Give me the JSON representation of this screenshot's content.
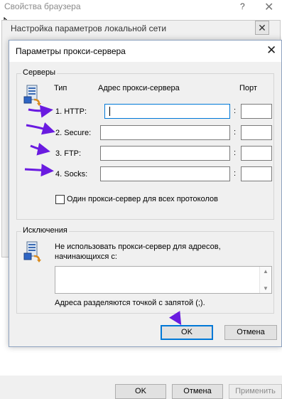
{
  "browser_window": {
    "title": "Свойства браузера",
    "help_glyph": "?",
    "close_glyph": "✕",
    "buttons": {
      "ok": "OK",
      "cancel": "Отмена",
      "apply": "Применить"
    }
  },
  "lan_window": {
    "title": "Настройка параметров локальной сети",
    "close_glyph": "✕"
  },
  "proxy_dialog": {
    "title": "Параметры прокси-сервера",
    "close_glyph": "✕",
    "servers_group": {
      "label": "Серверы",
      "col_type": "Тип",
      "col_address": "Адрес прокси-сервера",
      "col_port": "Порт",
      "rows": [
        {
          "label": "1. HTTP:",
          "address": "",
          "port": ""
        },
        {
          "label": "2. Secure:",
          "address": "",
          "port": ""
        },
        {
          "label": "3. FTP:",
          "address": "",
          "port": ""
        },
        {
          "label": "4. Socks:",
          "address": "",
          "port": ""
        }
      ],
      "colon": ":",
      "same_proxy_checkbox": {
        "label": "Один прокси-сервер для всех протоколов",
        "checked": false
      }
    },
    "exceptions_group": {
      "label": "Исключения",
      "description": "Не использовать прокси-сервер для адресов, начинающихся с:",
      "description_line1": "Не использовать прокси-сервер для адресов,",
      "description_line2": "начинающихся с:",
      "value": "",
      "hint": "Адреса разделяются точкой с запятой (;)."
    },
    "buttons": {
      "ok": "OK",
      "cancel": "Отмена"
    }
  },
  "colors": {
    "annotation_arrow": "#6a1be0",
    "focus_border": "#0078d7"
  },
  "icons": [
    "cursor-icon",
    "network-computer-icon",
    "annotation-arrow-icon"
  ]
}
